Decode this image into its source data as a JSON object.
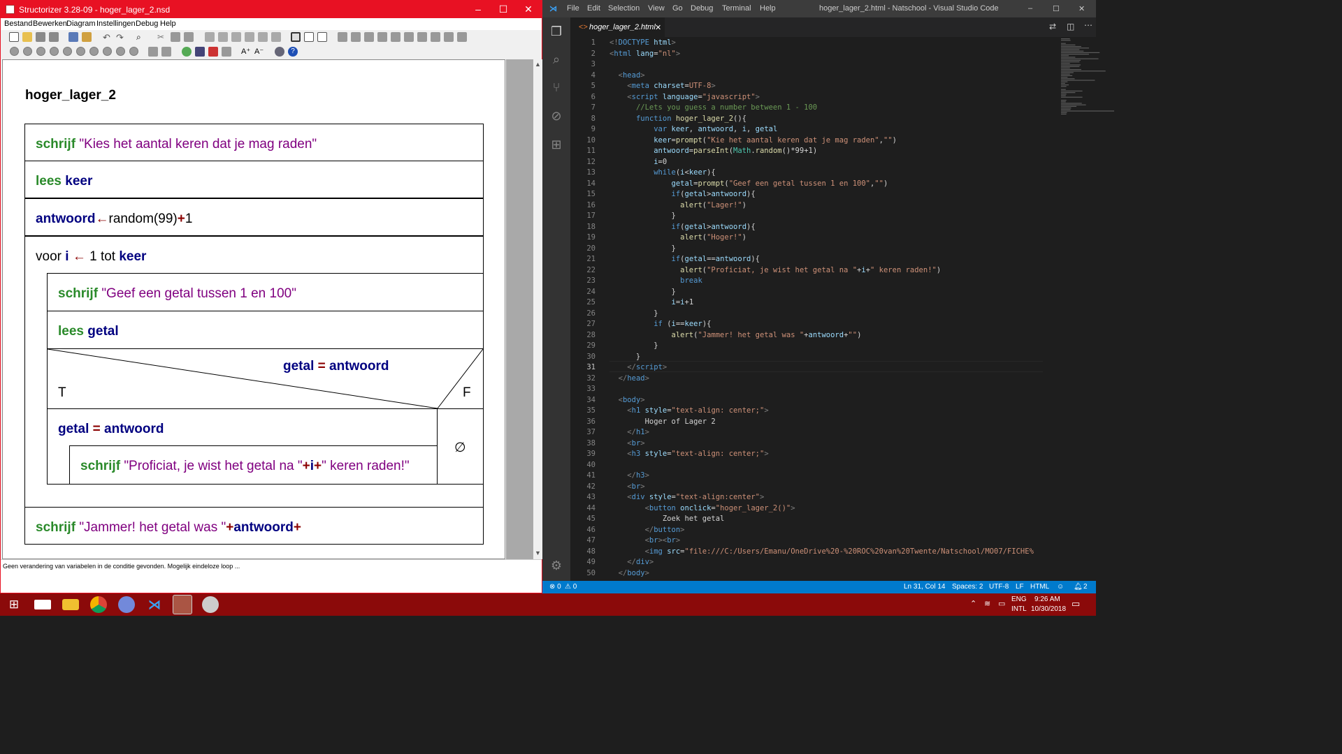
{
  "structorizer": {
    "title": "Structorizer 3.28-09 - hoger_lager_2.nsd",
    "menu": [
      "Bestand",
      "Bewerken",
      "Diagram",
      "Instellingen",
      "Debug",
      "Help"
    ],
    "diagram_name": "hoger_lager_2",
    "status_text": "Geen verandering van variabelen in de conditie gevonden. Mogelijk eindeloze loop ...",
    "nsd": {
      "b1_kw": "schrijf",
      "b1_str": "\"Kies het aantal keren dat je mag raden\"",
      "b2_kw": "lees",
      "b2_var": "keer",
      "b3_var": "antwoord",
      "b3_arrow": "←",
      "b3_rest": "random(99)",
      "b3_plus": "+",
      "b3_one": "1",
      "loop_pre": "voor",
      "loop_var": "i",
      "loop_arrow": "←",
      "loop_mid": "1 tot",
      "loop_end": "keer",
      "l1_kw": "schrijf",
      "l1_str": "\"Geef een getal tussen 1 en 100\"",
      "l2_kw": "lees",
      "l2_var": "getal",
      "cond_a": "getal",
      "cond_op": "=",
      "cond_b": "antwoord",
      "t_label": "T",
      "f_label": "F",
      "t1_a": "getal",
      "t1_op": "=",
      "t1_b": "antwoord",
      "t2_kw": "schrijf",
      "t2_str1": "\"Proficiat, je wist het getal na \"",
      "t2_op1": "+",
      "t2_var": "i",
      "t2_op2": "+",
      "t2_str2": "\" keren raden!\"",
      "empty": "∅",
      "b_last_kw": "schrijf",
      "b_last_str": "\"Jammer! het getal was \"",
      "b_last_op": "+",
      "b_last_var": "antwoord",
      "b_last_op2": "+"
    }
  },
  "vscode": {
    "menu": [
      "File",
      "Edit",
      "Selection",
      "View",
      "Go",
      "Debug",
      "Terminal",
      "Help"
    ],
    "title": "hoger_lager_2.html - Natschool - Visual Studio Code",
    "tab": "hoger_lager_2.html",
    "status": {
      "errors": "⊗ 0",
      "warnings": "⚠ 0",
      "pos": "Ln 31, Col 14",
      "spaces": "Spaces: 2",
      "enc": "UTF-8",
      "eol": "LF",
      "lang": "HTML",
      "bell": "2"
    },
    "lines": [
      [
        [
          "p",
          "<!"
        ],
        [
          "t",
          "DOCTYPE"
        ],
        [
          "a",
          " html"
        ],
        [
          "p",
          ">"
        ]
      ],
      [
        [
          "p",
          "<"
        ],
        [
          "t",
          "html"
        ],
        [
          "a",
          " lang"
        ],
        [
          "",
          "="
        ],
        [
          "s",
          "\"nl\""
        ],
        [
          "p",
          ">"
        ]
      ],
      [],
      [
        [
          "",
          "  "
        ],
        [
          "p",
          "<"
        ],
        [
          "t",
          "head"
        ],
        [
          "p",
          ">"
        ]
      ],
      [
        [
          "",
          "    "
        ],
        [
          "p",
          "<"
        ],
        [
          "t",
          "meta"
        ],
        [
          "a",
          " charset"
        ],
        [
          "",
          "="
        ],
        [
          "s",
          "UTF-8"
        ],
        [
          "p",
          ">"
        ]
      ],
      [
        [
          "",
          "    "
        ],
        [
          "p",
          "<"
        ],
        [
          "t",
          "script"
        ],
        [
          "a",
          " language"
        ],
        [
          "",
          "="
        ],
        [
          "s",
          "\"javascript\""
        ],
        [
          "p",
          ">"
        ]
      ],
      [
        [
          "",
          "      "
        ],
        [
          "c",
          "//Lets you guess a number between 1 - 100"
        ]
      ],
      [
        [
          "",
          "      "
        ],
        [
          "k",
          "function"
        ],
        [
          "",
          " "
        ],
        [
          "f",
          "hoger_lager_2"
        ],
        [
          "",
          "(){"
        ]
      ],
      [
        [
          "",
          "          "
        ],
        [
          "k",
          "var"
        ],
        [
          "v",
          " keer"
        ],
        [
          "",
          ", "
        ],
        [
          "v",
          "antwoord"
        ],
        [
          "",
          ", "
        ],
        [
          "v",
          "i"
        ],
        [
          "",
          ", "
        ],
        [
          "v",
          "getal"
        ]
      ],
      [
        [
          "",
          "          "
        ],
        [
          "v",
          "keer"
        ],
        [
          "",
          "="
        ],
        [
          "f",
          "prompt"
        ],
        [
          "",
          "("
        ],
        [
          "s",
          "\"Kie het aantal keren dat je mag raden\""
        ],
        [
          "",
          ","
        ],
        [
          "s",
          "\"\""
        ],
        [
          "",
          ")"
        ]
      ],
      [
        [
          "",
          "          "
        ],
        [
          "v",
          "antwoord"
        ],
        [
          "",
          "="
        ],
        [
          "f",
          "parseInt"
        ],
        [
          "",
          "("
        ],
        [
          "y",
          "Math"
        ],
        [
          "",
          "."
        ],
        [
          "f",
          "random"
        ],
        [
          "",
          "()*99+1)"
        ]
      ],
      [
        [
          "",
          "          "
        ],
        [
          "v",
          "i"
        ],
        [
          "",
          "=0"
        ]
      ],
      [
        [
          "",
          "          "
        ],
        [
          "k",
          "while"
        ],
        [
          "",
          "("
        ],
        [
          "v",
          "i"
        ],
        [
          "",
          "<"
        ],
        [
          "v",
          "keer"
        ],
        [
          "",
          "){"
        ]
      ],
      [
        [
          "",
          "              "
        ],
        [
          "v",
          "getal"
        ],
        [
          "",
          "="
        ],
        [
          "f",
          "prompt"
        ],
        [
          "",
          "("
        ],
        [
          "s",
          "\"Geef een getal tussen 1 en 100\""
        ],
        [
          "",
          ","
        ],
        [
          "s",
          "\"\""
        ],
        [
          "",
          ")"
        ]
      ],
      [
        [
          "",
          "              "
        ],
        [
          "k",
          "if"
        ],
        [
          "",
          "("
        ],
        [
          "v",
          "getal"
        ],
        [
          "",
          ">"
        ],
        [
          "v",
          "antwoord"
        ],
        [
          "",
          "){"
        ]
      ],
      [
        [
          "",
          "                "
        ],
        [
          "f",
          "alert"
        ],
        [
          "",
          "("
        ],
        [
          "s",
          "\"Lager!\""
        ],
        [
          "",
          ")"
        ]
      ],
      [
        [
          "",
          "              }"
        ]
      ],
      [
        [
          "",
          "              "
        ],
        [
          "k",
          "if"
        ],
        [
          "",
          "("
        ],
        [
          "v",
          "getal"
        ],
        [
          "",
          ">"
        ],
        [
          "v",
          "antwoord"
        ],
        [
          "",
          "){"
        ]
      ],
      [
        [
          "",
          "                "
        ],
        [
          "f",
          "alert"
        ],
        [
          "",
          "("
        ],
        [
          "s",
          "\"Hoger!\""
        ],
        [
          "",
          ")"
        ]
      ],
      [
        [
          "",
          "              }"
        ]
      ],
      [
        [
          "",
          "              "
        ],
        [
          "k",
          "if"
        ],
        [
          "",
          "("
        ],
        [
          "v",
          "getal"
        ],
        [
          "",
          "=="
        ],
        [
          "v",
          "antwoord"
        ],
        [
          "",
          "){"
        ]
      ],
      [
        [
          "",
          "                "
        ],
        [
          "f",
          "alert"
        ],
        [
          "",
          "("
        ],
        [
          "s",
          "\"Proficiat, je wist het getal na \""
        ],
        [
          "",
          "+"
        ],
        [
          "v",
          "i"
        ],
        [
          "",
          "+"
        ],
        [
          "s",
          "\" keren raden!\""
        ],
        [
          "",
          ")"
        ]
      ],
      [
        [
          "",
          "                "
        ],
        [
          "k",
          "break"
        ]
      ],
      [
        [
          "",
          "              }"
        ]
      ],
      [
        [
          "",
          "              "
        ],
        [
          "v",
          "i"
        ],
        [
          "",
          "="
        ],
        [
          "v",
          "i"
        ],
        [
          "",
          "+1"
        ]
      ],
      [
        [
          "",
          "          }"
        ]
      ],
      [
        [
          "",
          "          "
        ],
        [
          "k",
          "if"
        ],
        [
          "",
          " ("
        ],
        [
          "v",
          "i"
        ],
        [
          "",
          "=="
        ],
        [
          "v",
          "keer"
        ],
        [
          "",
          "){"
        ]
      ],
      [
        [
          "",
          "              "
        ],
        [
          "f",
          "alert"
        ],
        [
          "",
          "("
        ],
        [
          "s",
          "\"Jammer! het getal was \""
        ],
        [
          "",
          "+"
        ],
        [
          "v",
          "antwoord"
        ],
        [
          "",
          "+"
        ],
        [
          "s",
          "\"\""
        ],
        [
          "",
          ")"
        ]
      ],
      [
        [
          "",
          "          }"
        ]
      ],
      [
        [
          "",
          "      }"
        ]
      ],
      [
        [
          "",
          "    "
        ],
        [
          "p",
          "</"
        ],
        [
          "t",
          "script"
        ],
        [
          "p",
          ">"
        ]
      ],
      [
        [
          "",
          "  "
        ],
        [
          "p",
          "</"
        ],
        [
          "t",
          "head"
        ],
        [
          "p",
          ">"
        ]
      ],
      [],
      [
        [
          "",
          "  "
        ],
        [
          "p",
          "<"
        ],
        [
          "t",
          "body"
        ],
        [
          "p",
          ">"
        ]
      ],
      [
        [
          "",
          "    "
        ],
        [
          "p",
          "<"
        ],
        [
          "t",
          "h1"
        ],
        [
          "a",
          " style"
        ],
        [
          "",
          "="
        ],
        [
          "s",
          "\"text-align: center;\""
        ],
        [
          "p",
          ">"
        ]
      ],
      [
        [
          "",
          "        Hoger of Lager 2"
        ]
      ],
      [
        [
          "",
          "    "
        ],
        [
          "p",
          "</"
        ],
        [
          "t",
          "h1"
        ],
        [
          "p",
          ">"
        ]
      ],
      [
        [
          "",
          "    "
        ],
        [
          "p",
          "<"
        ],
        [
          "t",
          "br"
        ],
        [
          "p",
          ">"
        ]
      ],
      [
        [
          "",
          "    "
        ],
        [
          "p",
          "<"
        ],
        [
          "t",
          "h3"
        ],
        [
          "a",
          " style"
        ],
        [
          "",
          "="
        ],
        [
          "s",
          "\"text-align: center;\""
        ],
        [
          "p",
          ">"
        ]
      ],
      [],
      [
        [
          "",
          "    "
        ],
        [
          "p",
          "</"
        ],
        [
          "t",
          "h3"
        ],
        [
          "p",
          ">"
        ]
      ],
      [
        [
          "",
          "    "
        ],
        [
          "p",
          "<"
        ],
        [
          "t",
          "br"
        ],
        [
          "p",
          ">"
        ]
      ],
      [
        [
          "",
          "    "
        ],
        [
          "p",
          "<"
        ],
        [
          "t",
          "div"
        ],
        [
          "a",
          " style"
        ],
        [
          "",
          "="
        ],
        [
          "s",
          "\"text-align:center\""
        ],
        [
          "p",
          ">"
        ]
      ],
      [
        [
          "",
          "        "
        ],
        [
          "p",
          "<"
        ],
        [
          "t",
          "button"
        ],
        [
          "a",
          " onclick"
        ],
        [
          "",
          "="
        ],
        [
          "s",
          "\"hoger_lager_2()\""
        ],
        [
          "p",
          ">"
        ]
      ],
      [
        [
          "",
          "            Zoek het getal"
        ]
      ],
      [
        [
          "",
          "        "
        ],
        [
          "p",
          "</"
        ],
        [
          "t",
          "button"
        ],
        [
          "p",
          ">"
        ]
      ],
      [
        [
          "",
          "        "
        ],
        [
          "p",
          "<"
        ],
        [
          "t",
          "br"
        ],
        [
          "p",
          "><"
        ],
        [
          "t",
          "br"
        ],
        [
          "p",
          ">"
        ]
      ],
      [
        [
          "",
          "        "
        ],
        [
          "p",
          "<"
        ],
        [
          "t",
          "img"
        ],
        [
          "a",
          " src"
        ],
        [
          "",
          "="
        ],
        [
          "s",
          "\"file:///C:/Users/Emanu/OneDrive%20-%20ROC%20van%20Twente/Natschool/MO07/FICHE%"
        ]
      ],
      [
        [
          "",
          "    "
        ],
        [
          "p",
          "</"
        ],
        [
          "t",
          "div"
        ],
        [
          "p",
          ">"
        ]
      ],
      [
        [
          "",
          "  "
        ],
        [
          "p",
          "</"
        ],
        [
          "t",
          "body"
        ],
        [
          "p",
          ">"
        ]
      ]
    ]
  },
  "taskbar": {
    "lang1": "ENG",
    "lang2": "INTL",
    "time": "9:26 AM",
    "date": "10/30/2018"
  },
  "colors": {
    "structorizer_accent": "#e81123",
    "vscode_blue": "#007acc",
    "taskbar": "#8b0a0a"
  }
}
